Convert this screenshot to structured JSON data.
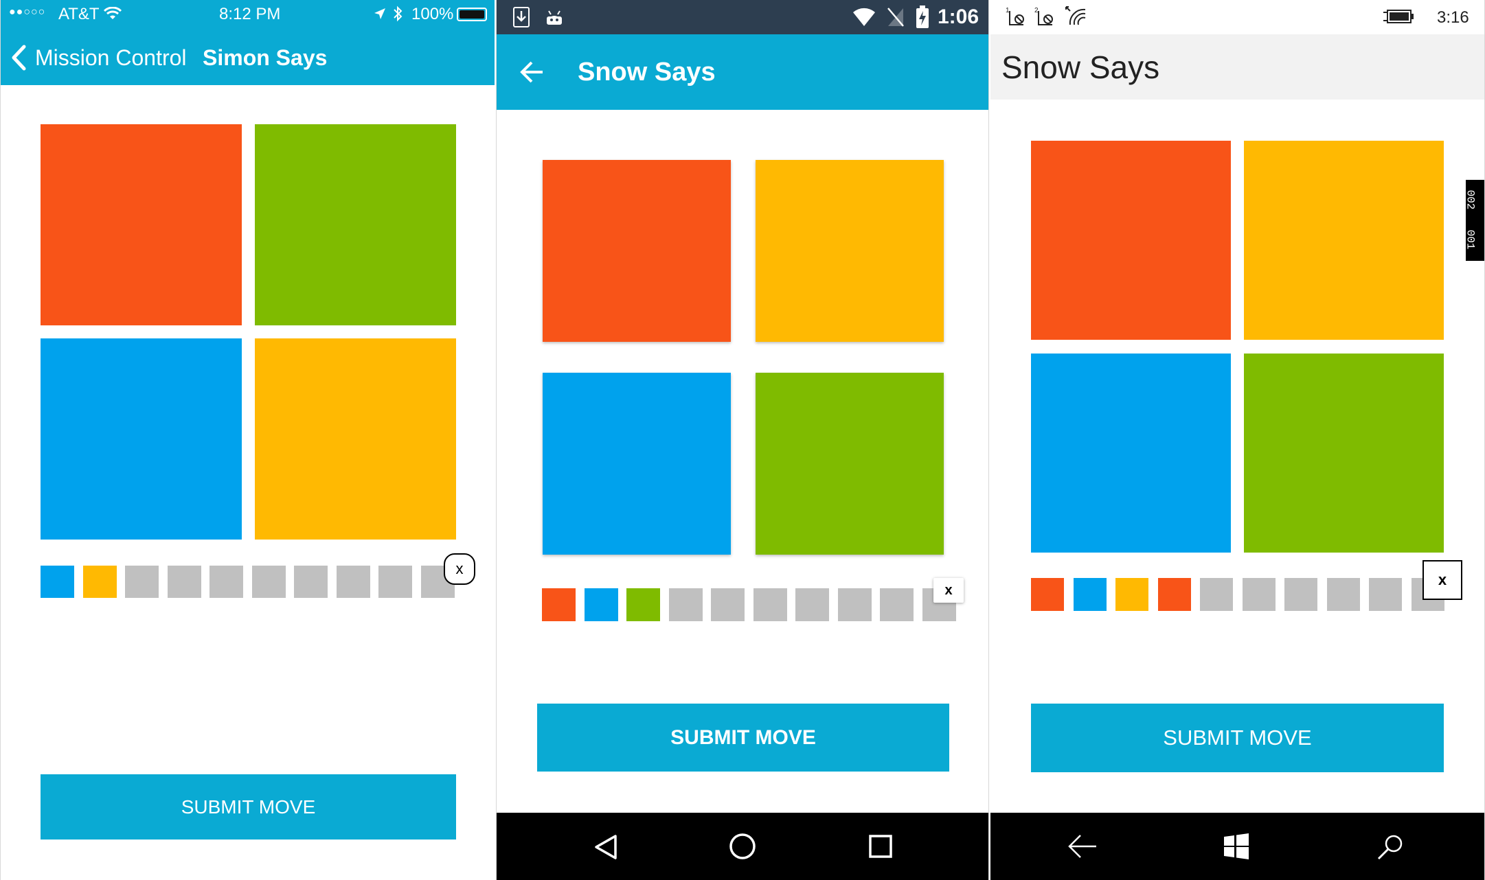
{
  "colors": {
    "red": "#f85418",
    "green": "#7fbb00",
    "blue": "#00a2ed",
    "yellow": "#ffb902",
    "gray": "#c0c0c0",
    "accent": "#0aaad3"
  },
  "ios": {
    "status": {
      "carrier": "AT&T",
      "time": "8:12 PM",
      "battery": "100%"
    },
    "nav": {
      "back_label": "Mission Control",
      "title": "Simon Says"
    },
    "tiles": [
      "red",
      "green",
      "blue",
      "yellow"
    ],
    "sequence": [
      "blue",
      "yellow",
      "gray",
      "gray",
      "gray",
      "gray",
      "gray",
      "gray",
      "gray",
      "gray"
    ],
    "clear_label": "x",
    "submit_label": "SUBMIT MOVE"
  },
  "android": {
    "status": {
      "time": "1:06"
    },
    "app_bar": {
      "title": "Snow Says"
    },
    "tiles": [
      "red",
      "yellow",
      "blue",
      "green"
    ],
    "sequence": [
      "red",
      "blue",
      "green",
      "gray",
      "gray",
      "gray",
      "gray",
      "gray",
      "gray",
      "gray"
    ],
    "clear_label": "x",
    "submit_label": "SUBMIT MOVE"
  },
  "windows": {
    "status": {
      "time": "3:16"
    },
    "header": {
      "title": "Snow Says"
    },
    "tiles": [
      "red",
      "yellow",
      "blue",
      "green"
    ],
    "sequence": [
      "red",
      "blue",
      "yellow",
      "red",
      "gray",
      "gray",
      "gray",
      "gray",
      "gray",
      "gray"
    ],
    "clear_label": "x",
    "submit_label": "SUBMIT MOVE",
    "debug_counter": [
      "002",
      "001"
    ]
  }
}
